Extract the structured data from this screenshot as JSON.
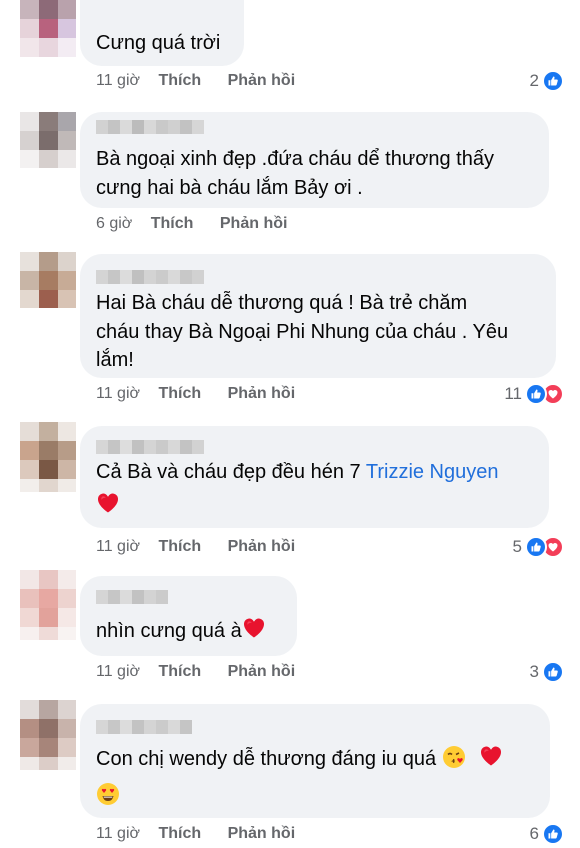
{
  "comments": [
    {
      "text": "Cưng quá trời",
      "time": "11 giờ",
      "like": "Thích",
      "reply": "Phản hồi",
      "count": "2",
      "icons": [
        "like-icon"
      ]
    },
    {
      "line1": "Bà ngoại xinh đẹp  .đứa cháu dể thương thấy",
      "line2": "cưng hai bà cháu lắm Bảy ơi .",
      "time": "6 giờ",
      "like": "Thích",
      "reply": "Phản hồi",
      "count": "",
      "icons": []
    },
    {
      "line1": "Hai Bà cháu dễ thương quá ! Bà trẻ chăm",
      "line2": "cháu thay Bà Ngoại Phi Nhung của cháu . Yêu",
      "line3": "lắm!",
      "time": "11 giờ",
      "like": "Thích",
      "reply": "Phản hồi",
      "count": "11",
      "icons": [
        "like-icon",
        "love-icon"
      ]
    },
    {
      "line1": "Cả Bà và cháu đẹp đều hén 7",
      "tag": "Trizzie Nguyen",
      "time": "11 giờ",
      "like": "Thích",
      "reply": "Phản hồi",
      "count": "5",
      "icons": [
        "like-icon",
        "love-icon"
      ]
    },
    {
      "text": "nhìn cưng quá à",
      "time": "11 giờ",
      "like": "Thích",
      "reply": "Phản hồi",
      "count": "3",
      "icons": [
        "like-icon"
      ]
    },
    {
      "text": "Con chị wendy dễ thương đáng iu quá",
      "time": "11 giờ",
      "like": "Thích",
      "reply": "Phản hồi",
      "count": "6",
      "icons": [
        "like-icon"
      ]
    }
  ],
  "colors": {
    "bubble": "#f0f2f5",
    "meta": "#65676b",
    "like_blue": "#1877f2",
    "love_red": "#f33e58",
    "tag_blue": "#216fdb"
  }
}
